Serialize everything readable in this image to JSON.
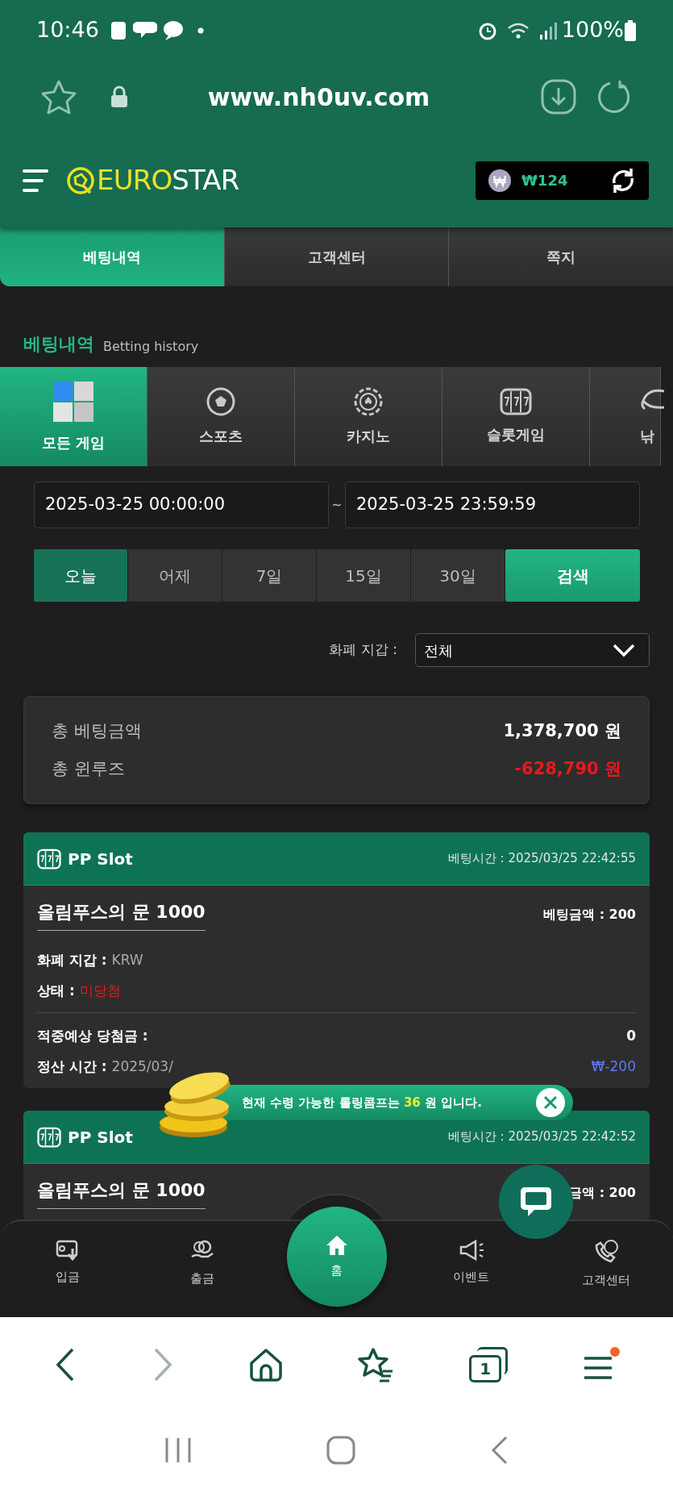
{
  "status_bar": {
    "time": "10:46",
    "battery": "100%"
  },
  "browser": {
    "url": "www.nh0uv.com",
    "tab_count": "1"
  },
  "header": {
    "logo_first": "EURO",
    "logo_second": "STAR",
    "balance": "₩124"
  },
  "top_tabs": [
    {
      "label": "베팅내역",
      "selected": true
    },
    {
      "label": "고객센터",
      "selected": false
    },
    {
      "label": "쪽지",
      "selected": false
    }
  ],
  "page_title": {
    "title": "베팅내역",
    "subtitle": "Betting history"
  },
  "categories": [
    {
      "kind": "all",
      "label": "모든 게임",
      "selected": true
    },
    {
      "kind": "sports",
      "label": "스포츠",
      "selected": false
    },
    {
      "kind": "casino",
      "label": "카지노",
      "selected": false
    },
    {
      "kind": "slot",
      "label": "슬롯게임",
      "selected": false
    },
    {
      "kind": "fishing",
      "label": "낚",
      "selected": false
    }
  ],
  "date_range": {
    "from": "2025-03-25 00:00:00",
    "separator": "~",
    "to": "2025-03-25 23:59:59"
  },
  "periods": [
    {
      "label": "오늘",
      "selected": true
    },
    {
      "label": "어제",
      "selected": false
    },
    {
      "label": "7일",
      "selected": false
    },
    {
      "label": "15일",
      "selected": false
    },
    {
      "label": "30일",
      "selected": false
    }
  ],
  "search_button": "검색",
  "wallet_filter": {
    "label": "화폐 지갑 :",
    "value": "전체"
  },
  "summary": [
    {
      "label": "총 베팅금액",
      "value": "1,378,700 원",
      "negative": false
    },
    {
      "label": "총 윈루즈",
      "value": "-628,790 원",
      "negative": true
    }
  ],
  "bets": [
    {
      "game": "PP Slot",
      "bet_time_label": "베팅시간 :",
      "bet_time": "2025/03/25 22:42:55",
      "title": "올림푸스의 문 1000",
      "bet_label": "베팅금액 :",
      "bet_amount": "200",
      "wallet_label": "화폐 지갑 :",
      "wallet": "KRW",
      "status_label": "상태 :",
      "status": "미당첨",
      "expected_label": "적중예상 당첨금 :",
      "expected": "0",
      "settle_label": "정산 시간 :",
      "settle_time": "2025/03/",
      "result": "₩-200"
    },
    {
      "game": "PP Slot",
      "bet_time_label": "베팅시간 :",
      "bet_time": "2025/03/25 22:42:52",
      "title": "올림푸스의 문 1000",
      "bet_label": "금액 :",
      "bet_amount": "200"
    }
  ],
  "toast": {
    "text": "현재 수령 가능한 롤링콤프는 **36** 원 입니다."
  },
  "bottom_nav": [
    {
      "kind": "deposit",
      "label": "입금"
    },
    {
      "kind": "withdraw",
      "label": "출금"
    },
    {
      "kind": "home",
      "label": "홈"
    },
    {
      "kind": "event",
      "label": "이벤트"
    },
    {
      "kind": "support",
      "label": "고객센터"
    }
  ]
}
